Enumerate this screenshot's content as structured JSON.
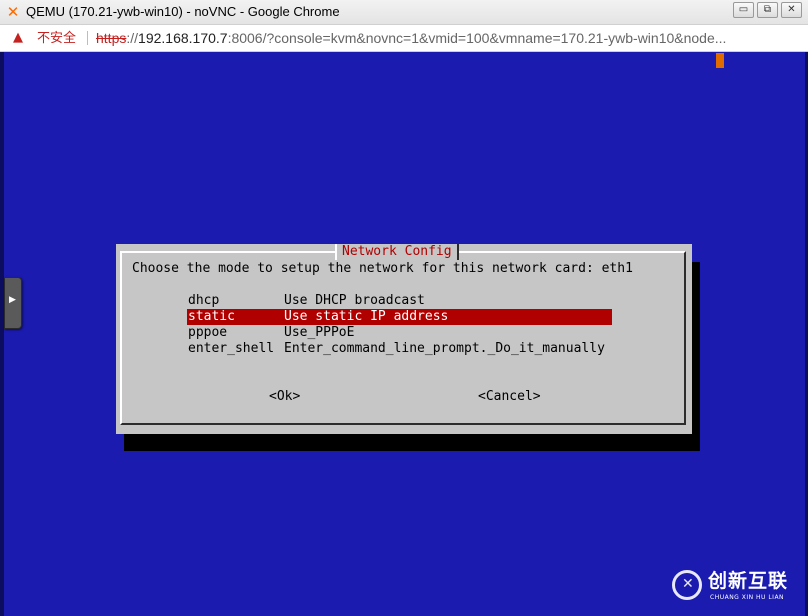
{
  "window": {
    "title": "QEMU (170.21-ywb-win10) - noVNC - Google Chrome",
    "controls": {
      "minimize": "▭",
      "restore": "⧉",
      "close": "✕"
    }
  },
  "addressbar": {
    "warning_label": "不安全",
    "url_scheme": "https",
    "url_sep": "://",
    "url_host": "192.168.170.7",
    "url_rest": ":8006/?console=kvm&novnc=1&vmid=100&vmname=170.21-ywb-win10&node..."
  },
  "dialog": {
    "title": "Network Config",
    "prompt": "Choose the mode to setup the network for this network card: eth1",
    "items": [
      {
        "tag": "dhcp",
        "desc": "Use DHCP broadcast"
      },
      {
        "tag": "static",
        "desc": "Use static IP address"
      },
      {
        "tag": "pppoe",
        "desc": "Use_PPPoE"
      },
      {
        "tag": "enter_shell",
        "desc": "Enter_command_line_prompt._Do_it_manually"
      }
    ],
    "selected_index": 1,
    "ok_label": "<Ok>",
    "cancel_label": "<Cancel>"
  },
  "watermark": {
    "name": "创新互联",
    "sub": "CHUANG XIN HU LIAN"
  },
  "colors": {
    "console_bg": "#1b1bb0",
    "dialog_bg": "#c6c6c6",
    "selection": "#b10000",
    "title_red": "#b00000"
  }
}
